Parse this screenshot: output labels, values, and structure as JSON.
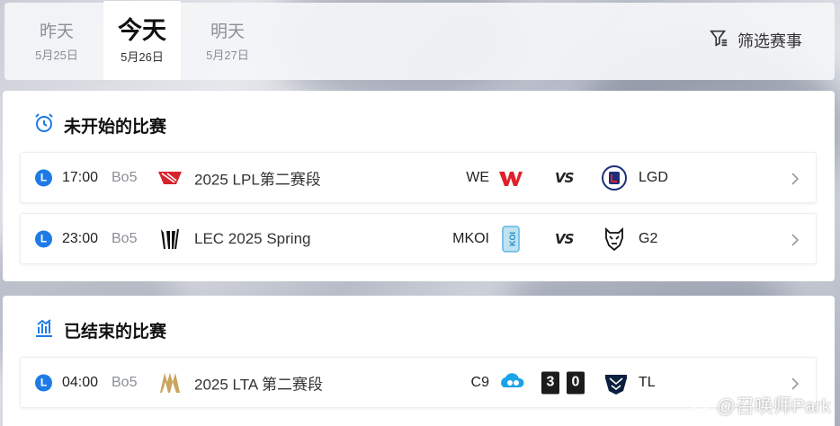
{
  "days": [
    {
      "name": "昨天",
      "date": "5月25日",
      "active": false
    },
    {
      "name": "今天",
      "date": "5月26日",
      "active": true
    },
    {
      "name": "明天",
      "date": "5月27日",
      "active": false
    }
  ],
  "filter_label": "筛选赛事",
  "sections": {
    "upcoming": {
      "title": "未开始的比赛",
      "icon": "alarm-clock-icon",
      "matches": [
        {
          "badge": "L",
          "time": "17:00",
          "format": "Bo5",
          "league": "2025 LPL第二赛段",
          "league_icon": "lpl-logo",
          "team_a": "WE",
          "team_a_icon": "we-logo",
          "vs": "VS",
          "team_b": "LGD",
          "team_b_icon": "lgd-logo"
        },
        {
          "badge": "L",
          "time": "23:00",
          "format": "Bo5",
          "league": "LEC 2025 Spring",
          "league_icon": "lec-logo",
          "team_a": "MKOI",
          "team_a_icon": "mkoi-logo",
          "vs": "VS",
          "team_b": "G2",
          "team_b_icon": "g2-logo"
        }
      ]
    },
    "ended": {
      "title": "已结束的比赛",
      "icon": "bar-chart-icon",
      "matches": [
        {
          "badge": "L",
          "time": "04:00",
          "format": "Bo5",
          "league": "2025 LTA 第二赛段",
          "league_icon": "lta-logo",
          "team_a": "C9",
          "team_a_icon": "c9-logo",
          "score_a": "3",
          "score_b": "0",
          "team_b": "TL",
          "team_b_icon": "tl-logo"
        }
      ]
    }
  },
  "watermark": "@召唤师Park",
  "colors": {
    "accent": "#1e7be6",
    "text": "#222222",
    "muted": "#8b8f96"
  }
}
